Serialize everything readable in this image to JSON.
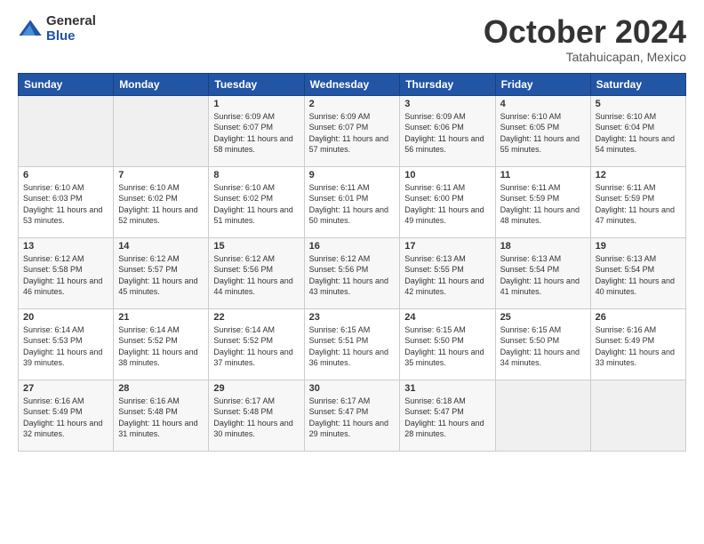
{
  "logo": {
    "general": "General",
    "blue": "Blue"
  },
  "header": {
    "month": "October 2024",
    "location": "Tatahuicapan, Mexico"
  },
  "days_of_week": [
    "Sunday",
    "Monday",
    "Tuesday",
    "Wednesday",
    "Thursday",
    "Friday",
    "Saturday"
  ],
  "weeks": [
    [
      {
        "day": "",
        "empty": true
      },
      {
        "day": "",
        "empty": true
      },
      {
        "day": "1",
        "sunrise": "6:09 AM",
        "sunset": "6:07 PM",
        "daylight": "11 hours and 58 minutes."
      },
      {
        "day": "2",
        "sunrise": "6:09 AM",
        "sunset": "6:07 PM",
        "daylight": "11 hours and 57 minutes."
      },
      {
        "day": "3",
        "sunrise": "6:09 AM",
        "sunset": "6:06 PM",
        "daylight": "11 hours and 56 minutes."
      },
      {
        "day": "4",
        "sunrise": "6:10 AM",
        "sunset": "6:05 PM",
        "daylight": "11 hours and 55 minutes."
      },
      {
        "day": "5",
        "sunrise": "6:10 AM",
        "sunset": "6:04 PM",
        "daylight": "11 hours and 54 minutes."
      }
    ],
    [
      {
        "day": "6",
        "sunrise": "6:10 AM",
        "sunset": "6:03 PM",
        "daylight": "11 hours and 53 minutes."
      },
      {
        "day": "7",
        "sunrise": "6:10 AM",
        "sunset": "6:02 PM",
        "daylight": "11 hours and 52 minutes."
      },
      {
        "day": "8",
        "sunrise": "6:10 AM",
        "sunset": "6:02 PM",
        "daylight": "11 hours and 51 minutes."
      },
      {
        "day": "9",
        "sunrise": "6:11 AM",
        "sunset": "6:01 PM",
        "daylight": "11 hours and 50 minutes."
      },
      {
        "day": "10",
        "sunrise": "6:11 AM",
        "sunset": "6:00 PM",
        "daylight": "11 hours and 49 minutes."
      },
      {
        "day": "11",
        "sunrise": "6:11 AM",
        "sunset": "5:59 PM",
        "daylight": "11 hours and 48 minutes."
      },
      {
        "day": "12",
        "sunrise": "6:11 AM",
        "sunset": "5:59 PM",
        "daylight": "11 hours and 47 minutes."
      }
    ],
    [
      {
        "day": "13",
        "sunrise": "6:12 AM",
        "sunset": "5:58 PM",
        "daylight": "11 hours and 46 minutes."
      },
      {
        "day": "14",
        "sunrise": "6:12 AM",
        "sunset": "5:57 PM",
        "daylight": "11 hours and 45 minutes."
      },
      {
        "day": "15",
        "sunrise": "6:12 AM",
        "sunset": "5:56 PM",
        "daylight": "11 hours and 44 minutes."
      },
      {
        "day": "16",
        "sunrise": "6:12 AM",
        "sunset": "5:56 PM",
        "daylight": "11 hours and 43 minutes."
      },
      {
        "day": "17",
        "sunrise": "6:13 AM",
        "sunset": "5:55 PM",
        "daylight": "11 hours and 42 minutes."
      },
      {
        "day": "18",
        "sunrise": "6:13 AM",
        "sunset": "5:54 PM",
        "daylight": "11 hours and 41 minutes."
      },
      {
        "day": "19",
        "sunrise": "6:13 AM",
        "sunset": "5:54 PM",
        "daylight": "11 hours and 40 minutes."
      }
    ],
    [
      {
        "day": "20",
        "sunrise": "6:14 AM",
        "sunset": "5:53 PM",
        "daylight": "11 hours and 39 minutes."
      },
      {
        "day": "21",
        "sunrise": "6:14 AM",
        "sunset": "5:52 PM",
        "daylight": "11 hours and 38 minutes."
      },
      {
        "day": "22",
        "sunrise": "6:14 AM",
        "sunset": "5:52 PM",
        "daylight": "11 hours and 37 minutes."
      },
      {
        "day": "23",
        "sunrise": "6:15 AM",
        "sunset": "5:51 PM",
        "daylight": "11 hours and 36 minutes."
      },
      {
        "day": "24",
        "sunrise": "6:15 AM",
        "sunset": "5:50 PM",
        "daylight": "11 hours and 35 minutes."
      },
      {
        "day": "25",
        "sunrise": "6:15 AM",
        "sunset": "5:50 PM",
        "daylight": "11 hours and 34 minutes."
      },
      {
        "day": "26",
        "sunrise": "6:16 AM",
        "sunset": "5:49 PM",
        "daylight": "11 hours and 33 minutes."
      }
    ],
    [
      {
        "day": "27",
        "sunrise": "6:16 AM",
        "sunset": "5:49 PM",
        "daylight": "11 hours and 32 minutes."
      },
      {
        "day": "28",
        "sunrise": "6:16 AM",
        "sunset": "5:48 PM",
        "daylight": "11 hours and 31 minutes."
      },
      {
        "day": "29",
        "sunrise": "6:17 AM",
        "sunset": "5:48 PM",
        "daylight": "11 hours and 30 minutes."
      },
      {
        "day": "30",
        "sunrise": "6:17 AM",
        "sunset": "5:47 PM",
        "daylight": "11 hours and 29 minutes."
      },
      {
        "day": "31",
        "sunrise": "6:18 AM",
        "sunset": "5:47 PM",
        "daylight": "11 hours and 28 minutes."
      },
      {
        "day": "",
        "empty": true
      },
      {
        "day": "",
        "empty": true
      }
    ]
  ],
  "labels": {
    "sunrise": "Sunrise:",
    "sunset": "Sunset:",
    "daylight": "Daylight:"
  }
}
